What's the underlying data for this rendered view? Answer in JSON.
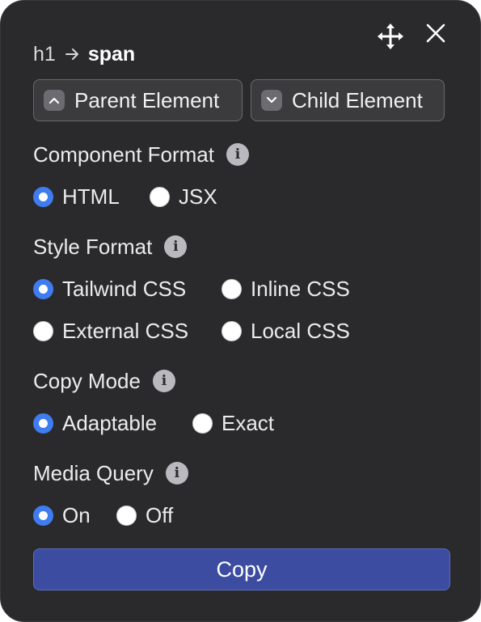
{
  "header": {
    "move_icon": "move-arrows-icon",
    "close_icon": "close-x-icon"
  },
  "breadcrumb": {
    "from": "h1",
    "to": "span"
  },
  "nav": {
    "parent_label": "Parent Element",
    "child_label": "Child Element"
  },
  "component_format": {
    "label": "Component Format",
    "options": [
      {
        "label": "HTML",
        "checked": true
      },
      {
        "label": "JSX",
        "checked": false
      }
    ]
  },
  "style_format": {
    "label": "Style Format",
    "options": [
      {
        "label": "Tailwind CSS",
        "checked": true
      },
      {
        "label": "Inline CSS",
        "checked": false
      },
      {
        "label": "External CSS",
        "checked": false
      },
      {
        "label": "Local CSS",
        "checked": false
      }
    ]
  },
  "copy_mode": {
    "label": "Copy Mode",
    "options": [
      {
        "label": "Adaptable",
        "checked": true
      },
      {
        "label": "Exact",
        "checked": false
      }
    ]
  },
  "media_query": {
    "label": "Media Query",
    "options": [
      {
        "label": "On",
        "checked": true
      },
      {
        "label": "Off",
        "checked": false
      }
    ]
  },
  "copy_button": {
    "label": "Copy"
  },
  "colors": {
    "panel_bg": "#2a2a2c",
    "accent_radio": "#3f7cf0",
    "copy_button_bg": "#3c4da1"
  }
}
